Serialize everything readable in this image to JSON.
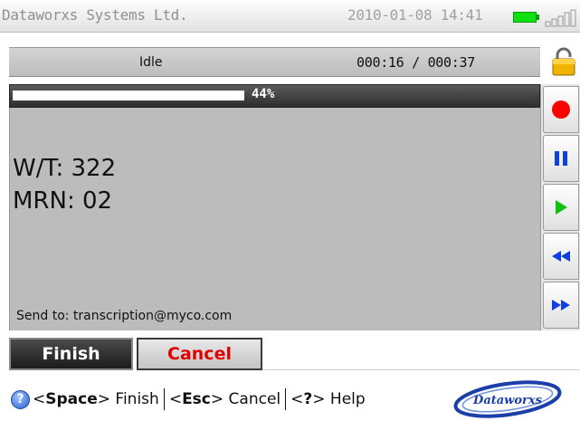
{
  "titlebar": {
    "app_title": "Dataworxs Systems Ltd.",
    "datetime": "2010-01-08 14:41",
    "battery_color": "#10e010",
    "signal_icon": "signal-bars-icon"
  },
  "status": {
    "state": "Idle",
    "time_counter": "000:16 / 000:37",
    "lock_icon": "padlock-icon"
  },
  "progress": {
    "percent": 44,
    "label": "44%"
  },
  "note": {
    "line1": "W/T: 322",
    "line2": "MRN: 02",
    "send_to": "Send to: transcription@myco.com"
  },
  "controls": [
    {
      "name": "record",
      "icon": "record-icon",
      "color": "#ff0000"
    },
    {
      "name": "pause",
      "icon": "pause-icon",
      "color": "#1040e0"
    },
    {
      "name": "play",
      "icon": "play-icon",
      "color": "#10c010"
    },
    {
      "name": "rewind",
      "icon": "rewind-icon",
      "color": "#1040e0"
    },
    {
      "name": "fast-forward",
      "icon": "fast-forward-icon",
      "color": "#1040e0"
    }
  ],
  "actions": {
    "finish_label": "Finish",
    "cancel_label": "Cancel",
    "cancel_color": "#e00000"
  },
  "help": {
    "icon": "help-icon",
    "space_key": "Space",
    "finish": "Finish",
    "esc_key": "Esc",
    "cancel": "Cancel",
    "help_key": "?",
    "help": "Help"
  },
  "logo": {
    "text": "Dataworxs"
  }
}
